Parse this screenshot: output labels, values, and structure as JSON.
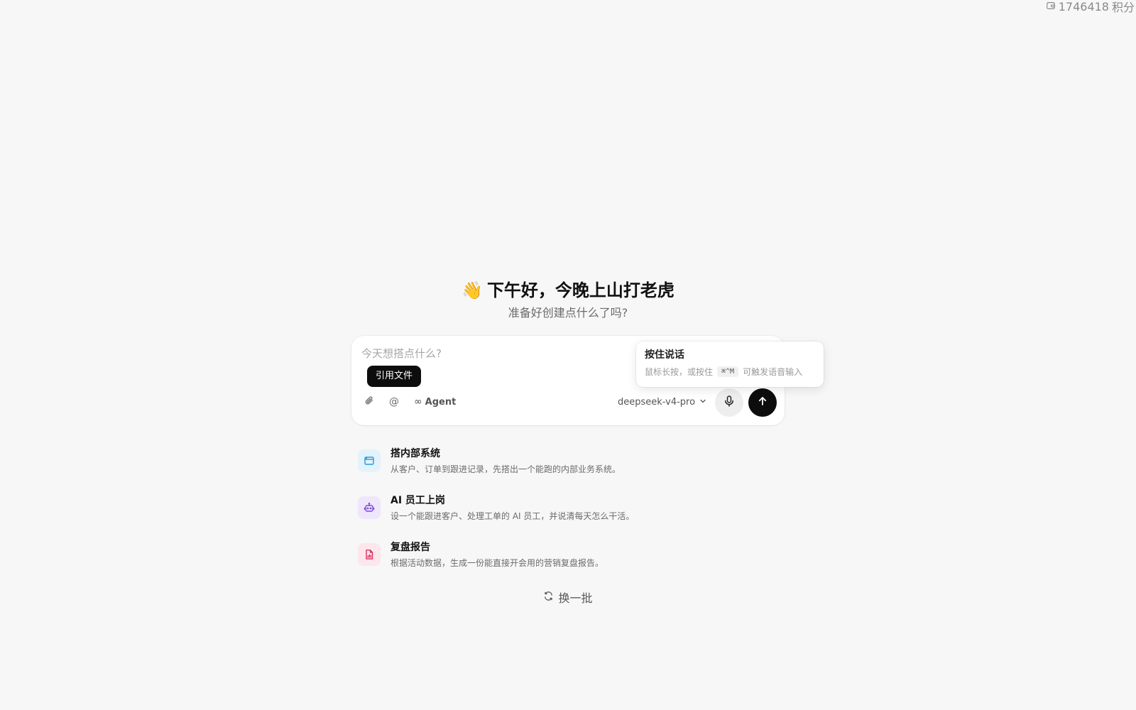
{
  "header": {
    "credits_value": "1746418",
    "credits_unit": "积分",
    "credits_icon": "wallet-icon"
  },
  "hero": {
    "wave_emoji": "👋",
    "greeting": "下午好，今晚上山打老虎",
    "subtitle": "准备好创建点什么了吗?"
  },
  "composer": {
    "placeholder": "今天想搭点什么?",
    "chip_label": "引用文件",
    "attach_icon": "paperclip-icon",
    "mention_label": "@",
    "agent_label": "Agent",
    "agent_icon": "infinity-icon",
    "model": "deepseek-v4-pro",
    "mic_icon": "microphone-icon",
    "send_icon": "arrow-up-icon"
  },
  "tooltip": {
    "title": "按住说话",
    "desc_prefix": "鼠标长按，或按住",
    "shortcut": "⌘^M",
    "desc_suffix": "可触发语音输入"
  },
  "suggestions": [
    {
      "title": "搭内部系统",
      "desc": "从客户、订单到跟进记录，先搭出一个能跑的内部业务系统。",
      "icon": "browser-window-icon",
      "accent": "#2a9bd6",
      "bg": "#e3f2fb"
    },
    {
      "title": "AI 员工上岗",
      "desc": "设一个能跟进客户、处理工单的 AI 员工，并说清每天怎么干活。",
      "icon": "robot-icon",
      "accent": "#7a4ad8",
      "bg": "#efe6fb"
    },
    {
      "title": "复盘报告",
      "desc": "根据活动数据，生成一份能直接开会用的营销复盘报告。",
      "icon": "report-document-icon",
      "accent": "#d8345f",
      "bg": "#fde6ec"
    }
  ],
  "refresh_label": "换一批"
}
